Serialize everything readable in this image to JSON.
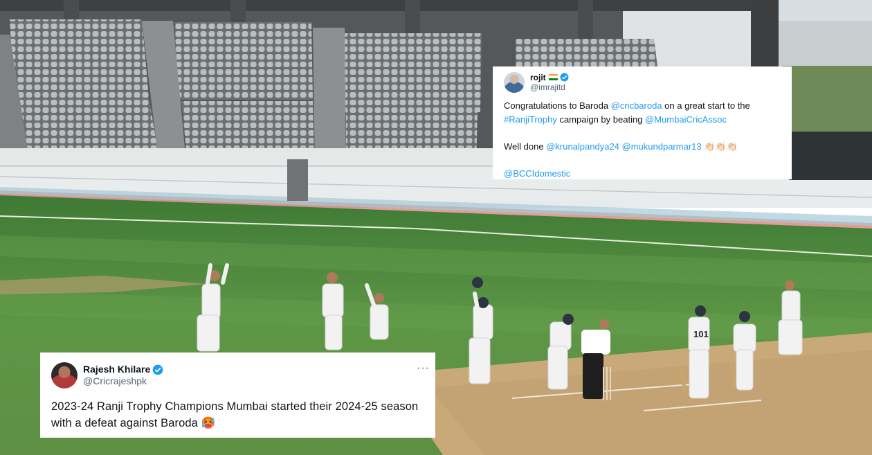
{
  "tweets": {
    "rojit": {
      "name": "rojit",
      "handle": "@imrajitd",
      "line1_pre": "Congratulations to Baroda ",
      "line1_mention": "@cricbaroda",
      "line1_post": " on a great start to the",
      "line2_hashtag": "#RanjiTrophy",
      "line2_mid": " campaign by beating ",
      "line2_mention": "@MumbaiCricAssoc",
      "line3_pre": "Well done ",
      "line3_mention1": "@krunalpandya24",
      "line3_sep": " ",
      "line3_mention2": "@mukundparmar13",
      "line3_emoji": "👏🏻👏🏻👏🏻",
      "line4_mention": "@BCCIdomestic"
    },
    "rajesh": {
      "name": "Rajesh Khilare",
      "handle": "@Cricrajeshpk",
      "more": "···",
      "text": "2023-24 Ranji Trophy Champions Mumbai started their 2024-25 season with a defeat against Baroda",
      "emoji": "🥵"
    }
  },
  "colors": {
    "link": "#1d9bf0",
    "verified": "#1d9bf0",
    "pitch": "#c9a978",
    "outfield": "#4f8a3f"
  },
  "icons": [
    "verified-badge-icon",
    "india-flag-icon",
    "more-options-icon"
  ]
}
